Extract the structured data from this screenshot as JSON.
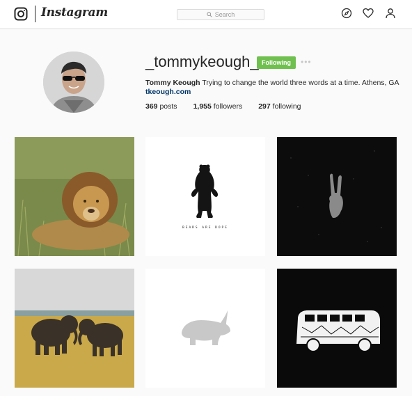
{
  "header": {
    "brand": "Instagram",
    "search_placeholder": "Search",
    "icons": [
      "instagram-logo-icon",
      "search-icon",
      "explore-compass-icon",
      "heart-icon",
      "profile-icon"
    ]
  },
  "profile": {
    "username": "_tommykeough_",
    "follow_label": "Following",
    "more_label": "•••",
    "display_name": "Tommy Keough",
    "bio": "Trying to change the world three words at a time. Athens, GA",
    "website": "tkeough.com",
    "stats": {
      "posts_count": "369",
      "posts_label": "posts",
      "followers_count": "1,955",
      "followers_label": "followers",
      "following_count": "297",
      "following_label": "following"
    }
  },
  "posts": [
    {
      "subject": "lion-in-grass"
    },
    {
      "subject": "standing-bear",
      "caption": "BEARS ARE DOPE"
    },
    {
      "subject": "peace-sign-hand"
    },
    {
      "subject": "two-elephants"
    },
    {
      "subject": "double-exposure-rhino"
    },
    {
      "subject": "vw-bus-illustration"
    }
  ],
  "colors": {
    "follow_green": "#70c050",
    "link_blue": "#003569",
    "border": "#dbdbdb",
    "background": "#fafafa"
  }
}
